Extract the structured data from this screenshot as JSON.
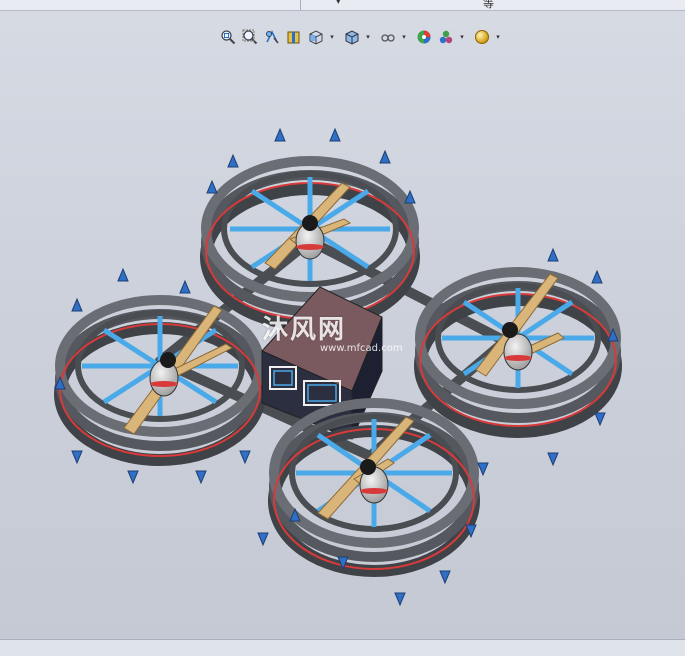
{
  "top_strip": {
    "dropdown_arrow": "▾",
    "tab_glyph": "等"
  },
  "toolbar": {
    "items": [
      {
        "icon": "zoom-to-fit-icon"
      },
      {
        "icon": "zoom-to-area-icon"
      },
      {
        "icon": "previous-view-icon"
      },
      {
        "icon": "section-view-icon"
      },
      {
        "icon": "view-orientation-icon",
        "dropdown": true
      },
      {
        "icon": "display-style-icon",
        "dropdown": true
      },
      {
        "icon": "hide-show-items-icon",
        "dropdown": true
      },
      {
        "icon": "edit-appearance-icon"
      },
      {
        "icon": "apply-scene-icon",
        "dropdown": true
      },
      {
        "icon": "view-settings-icon",
        "dropdown": true
      }
    ]
  },
  "watermark": {
    "brand": "沐风网",
    "url": "www.mfcad.com"
  },
  "colors": {
    "frame": "#4a4d52",
    "spoke": "#4aa9e8",
    "prop": "#d9b57a",
    "fin": "#2f6fc6",
    "stripe": "#d83a3a",
    "body_top": "#7a5a5e"
  }
}
